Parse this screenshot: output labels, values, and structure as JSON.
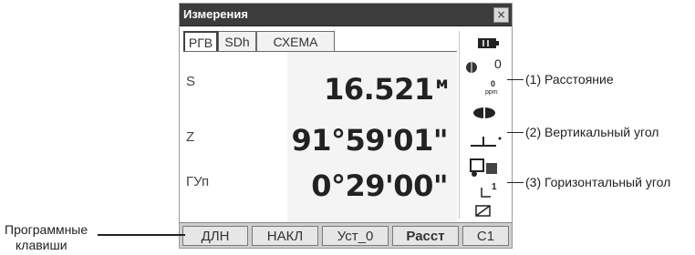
{
  "window": {
    "title": "Измерения",
    "close_glyph": "×"
  },
  "tabs": [
    {
      "label": "РГВ"
    },
    {
      "label": "SDh"
    },
    {
      "label": "СХЕМА"
    }
  ],
  "measurements": [
    {
      "label": "S",
      "value": "16.521",
      "unit": "м"
    },
    {
      "label": "Z",
      "value": "91°59'01\"",
      "unit": ""
    },
    {
      "label": "ГУп",
      "value": "0°29'00\"",
      "unit": ""
    }
  ],
  "status": {
    "prism_constant": "0",
    "ppm_value": "0",
    "ppm_label": "ppm",
    "tilt_sub": "1",
    "icons": [
      "battery-icon",
      "target-icon",
      "ppm-icon",
      "laser-icon",
      "tilt-icon",
      "communication-icon",
      "page-icon",
      "input-icon"
    ]
  },
  "softkeys": [
    {
      "label": "ДЛН"
    },
    {
      "label": "НАКЛ"
    },
    {
      "label": "Уст_0"
    },
    {
      "label": "Расст"
    },
    {
      "label": "С1"
    }
  ],
  "annotations": {
    "distance": "(1) Расстояние",
    "vertical": "(2) Вертикальный угол",
    "horizontal": "(3) Горизонтальный угол",
    "softkeys_line1": "Программные",
    "softkeys_line2": "клавиши"
  },
  "colors": {
    "titlebar": "#3c3c3c",
    "softkey_bar": "#cfcfcf",
    "value_bg": "#f4f4f4"
  }
}
